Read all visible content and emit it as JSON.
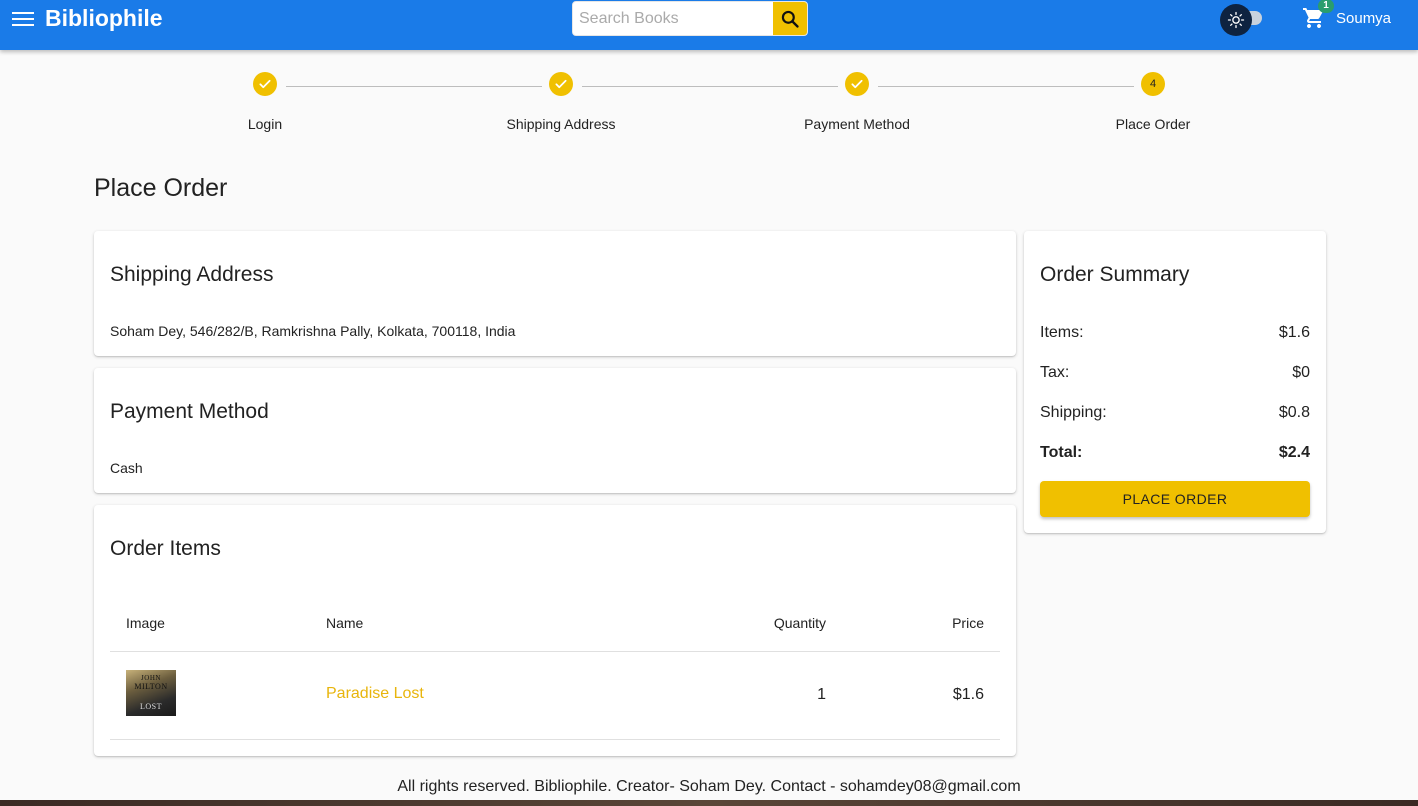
{
  "header": {
    "brand": "Bibliophile",
    "search_placeholder": "Search Books",
    "cart_count": "1",
    "user_name": "Soumya"
  },
  "stepper": {
    "steps": [
      {
        "label": "Login",
        "state": "done"
      },
      {
        "label": "Shipping Address",
        "state": "done"
      },
      {
        "label": "Payment Method",
        "state": "done"
      },
      {
        "label": "Place Order",
        "state": "active",
        "number": "4"
      }
    ]
  },
  "page": {
    "title": "Place Order"
  },
  "shipping": {
    "title": "Shipping Address",
    "address": "Soham Dey, 546/282/B, Ramkrishna Pally, Kolkata, 700118, India"
  },
  "payment": {
    "title": "Payment Method",
    "method": "Cash"
  },
  "order_items": {
    "title": "Order Items",
    "columns": [
      "Image",
      "Name",
      "Quantity",
      "Price"
    ],
    "rows": [
      {
        "cover_text": [
          "JOHN",
          "MILTON",
          "LOST"
        ],
        "name": "Paradise Lost",
        "quantity": "1",
        "price": "$1.6"
      }
    ]
  },
  "summary": {
    "title": "Order Summary",
    "items_label": "Items:",
    "items_value": "$1.6",
    "tax_label": "Tax:",
    "tax_value": "$0",
    "shipping_label": "Shipping:",
    "shipping_value": "$0.8",
    "total_label": "Total:",
    "total_value": "$2.4",
    "button_label": "PLACE ORDER"
  },
  "footer": {
    "text": "All rights reserved. Bibliophile. Creator- Soham Dey. Contact - sohamdey08@gmail.com"
  },
  "colors": {
    "appbar": "#1a7be8",
    "accent": "#f0c000",
    "link": "#e8b50c",
    "badge": "#2a9d6d"
  }
}
